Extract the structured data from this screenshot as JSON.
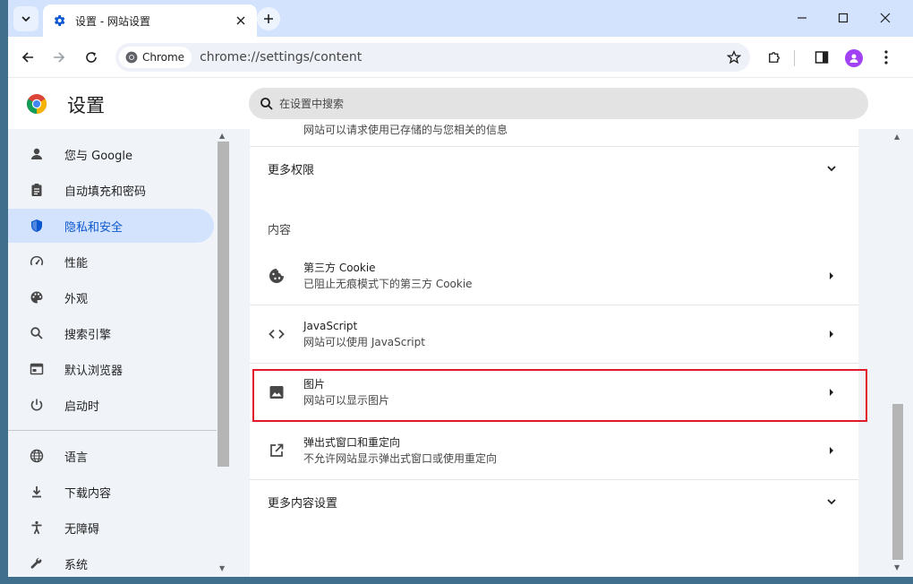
{
  "tab": {
    "title": "设置 - 网站设置"
  },
  "omnibox": {
    "chip_label": "Chrome",
    "url": "chrome://settings/content"
  },
  "header": {
    "title": "设置",
    "search_placeholder": "在设置中搜索"
  },
  "sidebar": {
    "items": [
      {
        "label": "您与 Google",
        "icon": "person-icon",
        "active": false
      },
      {
        "label": "自动填充和密码",
        "icon": "clipboard-icon",
        "active": false
      },
      {
        "label": "隐私和安全",
        "icon": "shield-icon",
        "active": true
      },
      {
        "label": "性能",
        "icon": "speedometer-icon",
        "active": false
      },
      {
        "label": "外观",
        "icon": "palette-icon",
        "active": false
      },
      {
        "label": "搜索引擎",
        "icon": "search-icon",
        "active": false
      },
      {
        "label": "默认浏览器",
        "icon": "browser-icon",
        "active": false
      },
      {
        "label": "启动时",
        "icon": "power-icon",
        "active": false
      },
      {
        "label": "语言",
        "icon": "globe-icon",
        "active": false
      },
      {
        "label": "下载内容",
        "icon": "download-icon",
        "active": false
      },
      {
        "label": "无障碍",
        "icon": "accessibility-icon",
        "active": false
      },
      {
        "label": "系统",
        "icon": "wrench-icon",
        "active": false
      }
    ]
  },
  "main": {
    "cutoff_text": "网站可以请求使用已存储的与您相关的信息",
    "more_permissions": "更多权限",
    "content_section": "内容",
    "rows": [
      {
        "title": "第三方 Cookie",
        "subtitle": "已阻止无痕模式下的第三方 Cookie",
        "icon": "cookie-icon"
      },
      {
        "title": "JavaScript",
        "subtitle": "网站可以使用 JavaScript",
        "icon": "code-icon"
      },
      {
        "title": "图片",
        "subtitle": "网站可以显示图片",
        "icon": "image-icon"
      },
      {
        "title": "弹出式窗口和重定向",
        "subtitle": "不允许网站显示弹出式窗口或使用重定向",
        "icon": "external-link-icon"
      }
    ],
    "more_content": "更多内容设置"
  },
  "colors": {
    "accent": "#0b57d0",
    "highlight": "#e0182a",
    "tabstrip": "#d3e3fd",
    "page_bg": "#f0f4f9"
  }
}
